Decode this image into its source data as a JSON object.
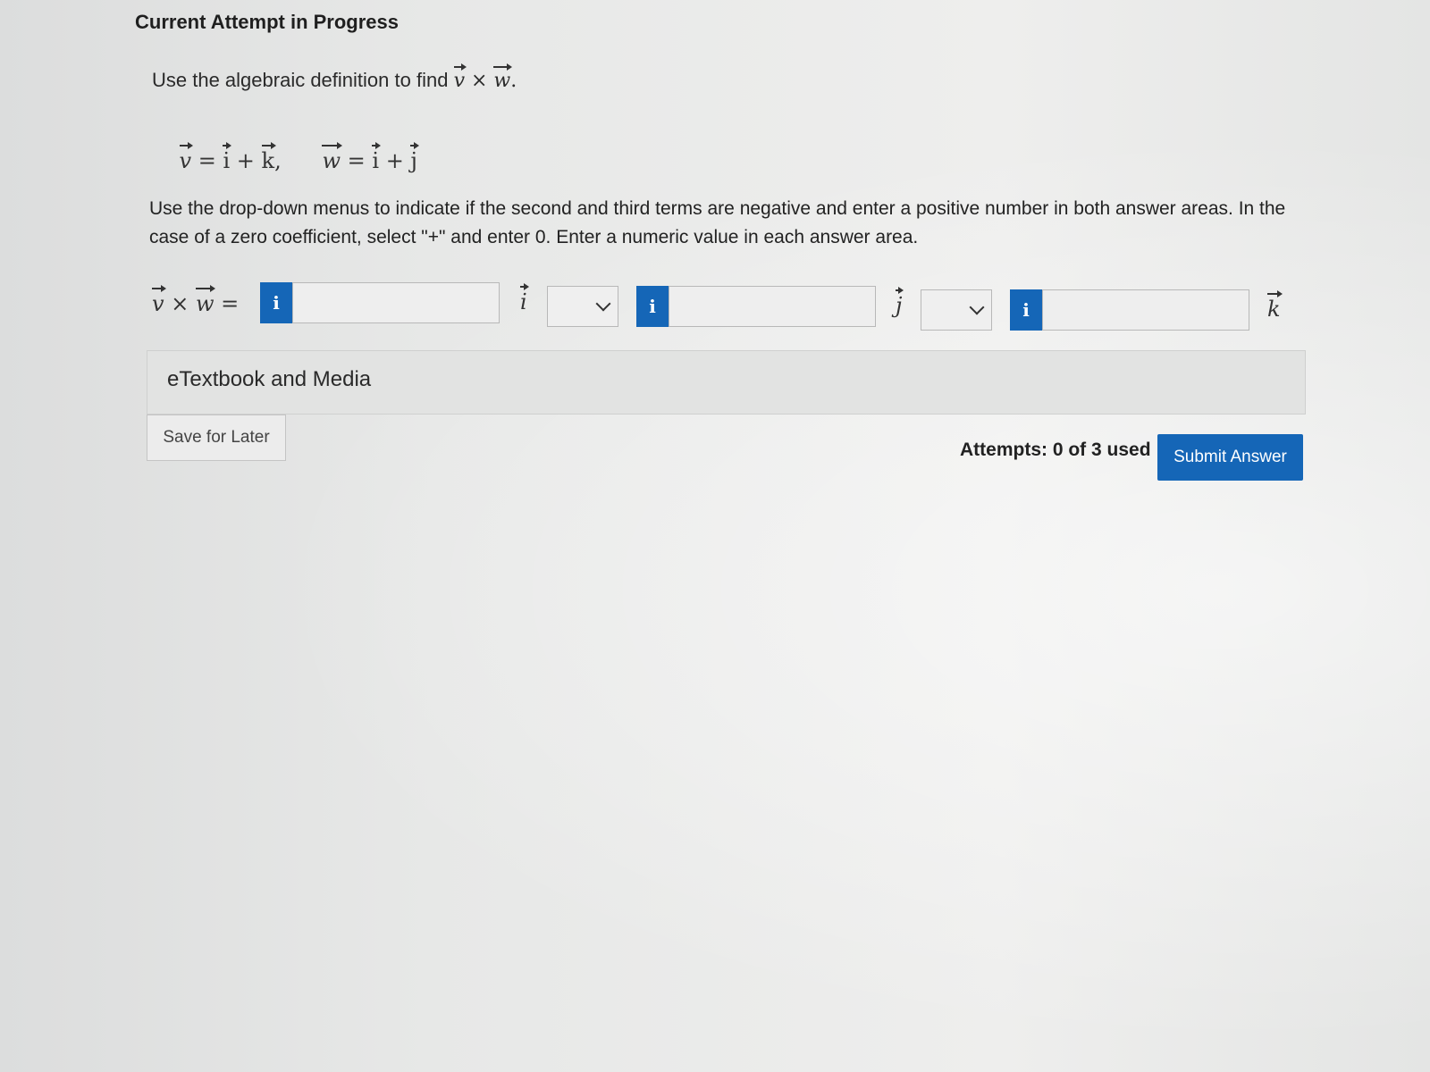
{
  "header": {
    "title": "Current Attempt in Progress"
  },
  "question": {
    "instruction_prefix": "Use the algebraic definition to find",
    "instruction_vec_v": "v",
    "instruction_cross": " × ",
    "instruction_vec_w": "w",
    "instruction_period": ".",
    "v_def": {
      "name": "v",
      "eq": " = ",
      "term1": "i",
      "plus": " + ",
      "term2": "k",
      "comma": ","
    },
    "w_def": {
      "name": "w",
      "eq": " = ",
      "term1": "i",
      "plus": " + ",
      "term2": "j"
    },
    "dropdown_instruction": "Use the drop-down menus to indicate if the second and third terms are negative and enter a positive number in both answer areas. In the case of a zero coefficient, select \"+\" and enter 0. Enter a numeric value in each answer area."
  },
  "answer": {
    "lhs_v": "v",
    "lhs_cross": " × ",
    "lhs_w": "w",
    "lhs_eq": " = ",
    "info_label": "i",
    "input1_value": "",
    "unit1": "i",
    "sign1_value": "",
    "input2_value": "",
    "unit2": "j",
    "sign2_value": "",
    "input3_value": "",
    "unit3": "k"
  },
  "resources": {
    "etextbook_label": "eTextbook and Media"
  },
  "footer": {
    "save_label": "Save for Later",
    "attempts_text": "Attempts: 0 of 3 used",
    "submit_label": "Submit Answer"
  },
  "colors": {
    "accent": "#1566b7",
    "background": "#e6e7e6"
  }
}
